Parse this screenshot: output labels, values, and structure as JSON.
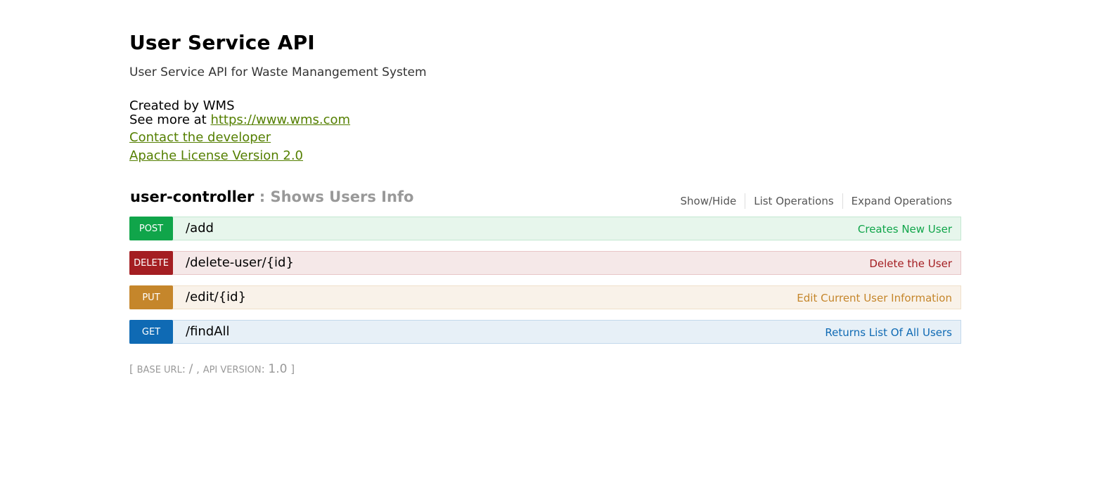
{
  "info": {
    "title": "User Service API",
    "description": "User Service API for Waste Manangement System",
    "created_by": "Created by WMS",
    "see_more_prefix": "See more at",
    "see_more_link": "https://www.wms.com",
    "contact_link": "Contact the developer",
    "license_link": "Apache License Version 2.0"
  },
  "resource": {
    "name": "user-controller",
    "separator": " : ",
    "description": "Shows Users Info",
    "actions": [
      "Show/Hide",
      "List Operations",
      "Expand Operations"
    ]
  },
  "operations": [
    {
      "method": "POST",
      "path": "/add",
      "summary": "Creates New User",
      "color": "#10a54a"
    },
    {
      "method": "DELETE",
      "path": "/delete-user/{id}",
      "summary": "Delete the User",
      "color": "#a41e22"
    },
    {
      "method": "PUT",
      "path": "/edit/{id}",
      "summary": "Edit Current User Information",
      "color": "#c5862b"
    },
    {
      "method": "GET",
      "path": "/findAll",
      "summary": "Returns List Of All Users",
      "color": "#0f6ab4"
    }
  ],
  "footer": {
    "open": "[ ",
    "base_label": "BASE URL",
    "colon1": ": ",
    "base_value": "/",
    "comma": " , ",
    "version_label": "API VERSION",
    "colon2": ": ",
    "version_value": "1.0",
    "close": " ]"
  }
}
